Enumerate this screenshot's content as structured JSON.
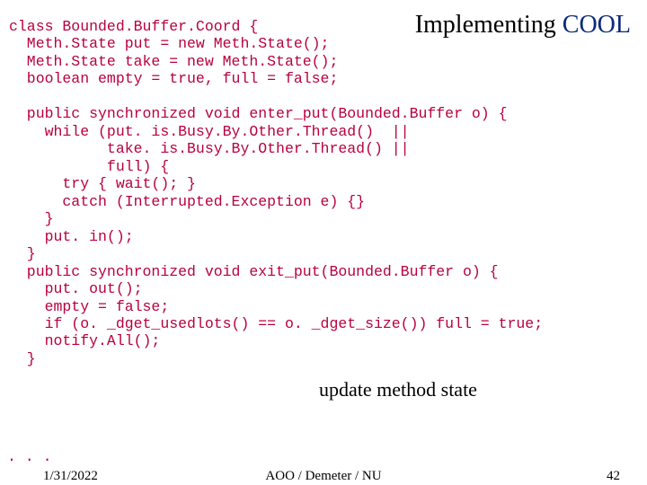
{
  "title": {
    "prefix": "Implementing ",
    "highlight": "COOL"
  },
  "code_lines": [
    "class Bounded.Buffer.Coord {",
    "  Meth.State put = new Meth.State();",
    "  Meth.State take = new Meth.State();",
    "  boolean empty = true, full = false;",
    "",
    "  public synchronized void enter_put(Bounded.Buffer o) {",
    "    while (put. is.Busy.By.Other.Thread()  ||",
    "           take. is.Busy.By.Other.Thread() ||",
    "           full) {",
    "      try { wait(); }",
    "      catch (Interrupted.Exception e) {}",
    "    }",
    "    put. in();",
    "  }",
    "  public synchronized void exit_put(Bounded.Buffer o) {",
    "    put. out();",
    "    empty = false;",
    "    if (o. _dget_usedlots() == o. _dget_size()) full = true;",
    "    notify.All();",
    "  }"
  ],
  "dots": ". . .",
  "annotation": "update method state",
  "footer": {
    "date": "1/31/2022",
    "center": "AOO / Demeter / NU",
    "page": "42"
  }
}
